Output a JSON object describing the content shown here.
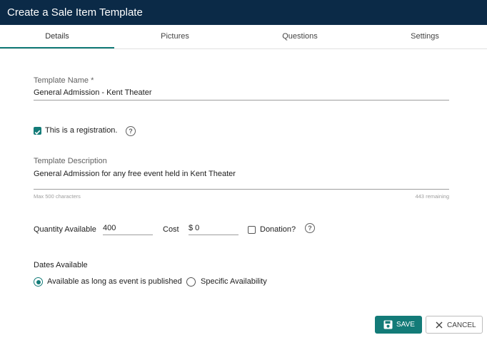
{
  "window": {
    "title": "Create a Sale Item Template"
  },
  "tabs": [
    {
      "label": "Details",
      "active": true
    },
    {
      "label": "Pictures",
      "active": false
    },
    {
      "label": "Questions",
      "active": false
    },
    {
      "label": "Settings",
      "active": false
    }
  ],
  "template_name": {
    "label": "Template Name *",
    "value": "General Admission - Kent Theater"
  },
  "registration": {
    "label": "This is a registration.",
    "checked": true
  },
  "description": {
    "label": "Template Description",
    "value": "General Admission for any free event held in Kent Theater",
    "max_hint": "Max 500 characters",
    "remaining": "443 remaining"
  },
  "quantity": {
    "label": "Quantity Available",
    "value": "400"
  },
  "cost": {
    "label": "Cost",
    "value": "$ 0"
  },
  "donation": {
    "label": "Donation?",
    "checked": false
  },
  "dates": {
    "heading": "Dates Available",
    "options": [
      {
        "label": "Available as long as event is published",
        "selected": true
      },
      {
        "label": "Specific Availability",
        "selected": false
      }
    ]
  },
  "actions": {
    "save_label": "SAVE",
    "cancel_label": "CANCEL"
  },
  "colors": {
    "header_bg": "#0b2a47",
    "accent": "#137b78"
  },
  "icons": {
    "help": "help-circle-icon",
    "save": "floppy-disk-icon",
    "cancel": "close-icon"
  }
}
